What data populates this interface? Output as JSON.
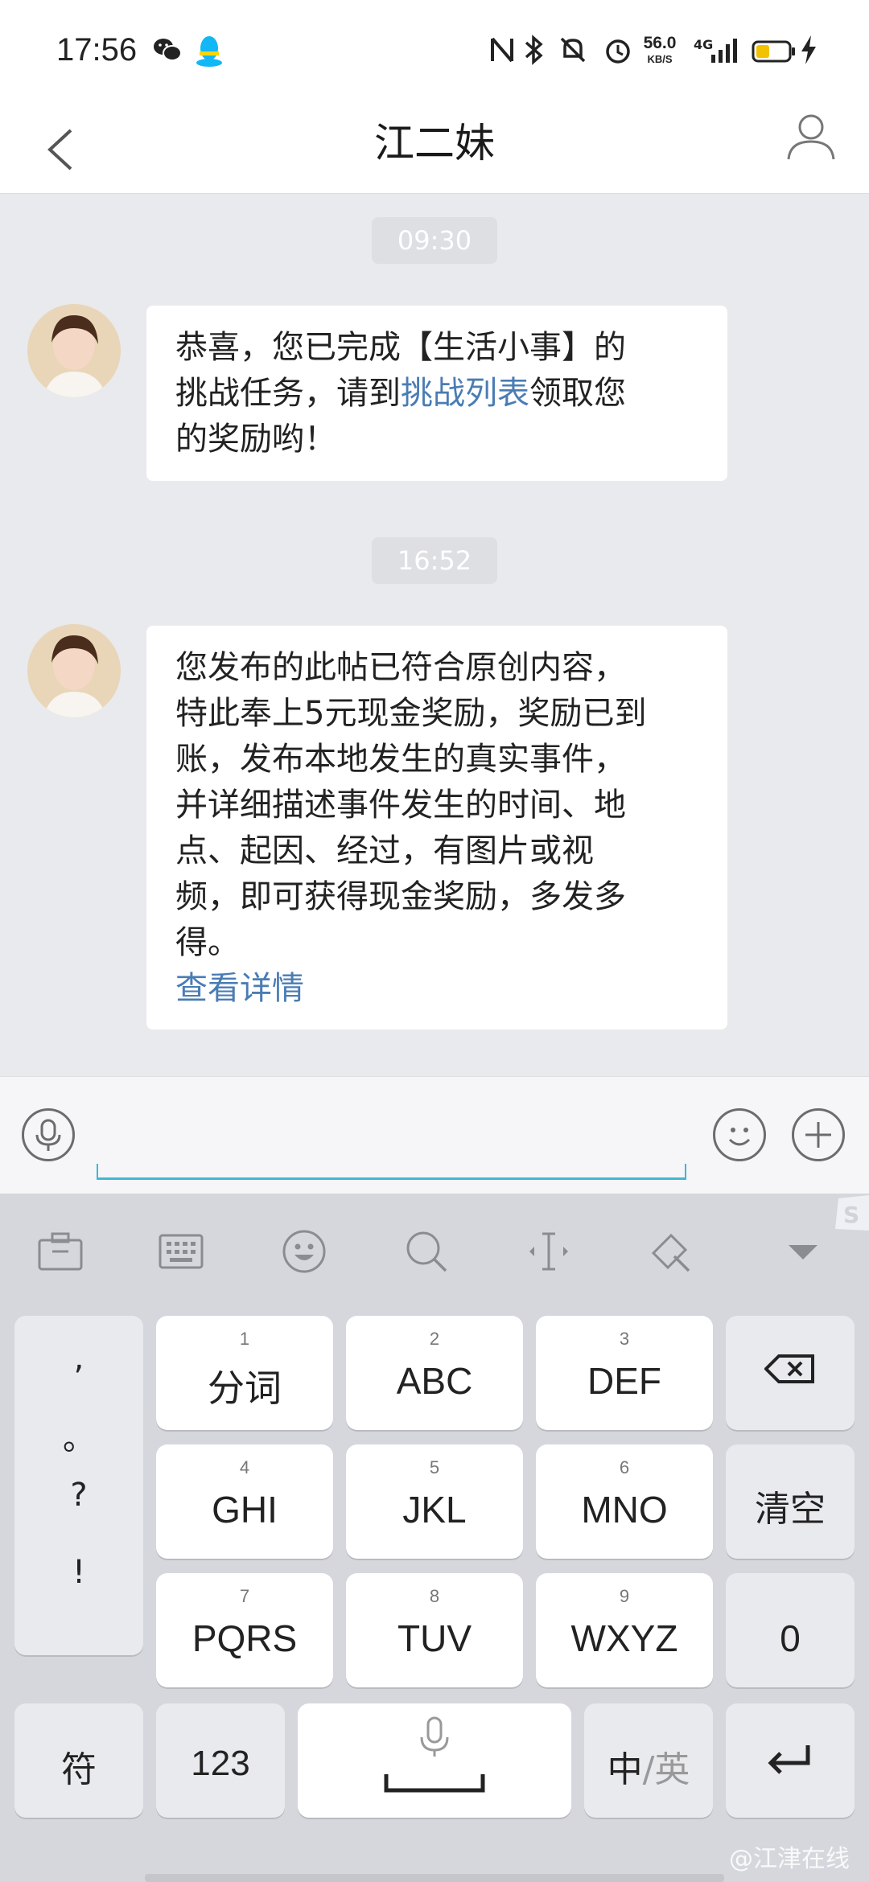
{
  "status_bar": {
    "time": "17:56",
    "net_speed_value": "56.0",
    "net_speed_unit": "KB/S",
    "network": "4G",
    "icons": [
      "wechat-icon",
      "qq-icon",
      "nfc-icon",
      "bluetooth-icon",
      "mute-icon",
      "alarm-icon",
      "signal-icon",
      "battery-icon",
      "charging-icon"
    ]
  },
  "header": {
    "title": "江二妹",
    "back_icon": "chevron-left-icon",
    "profile_icon": "person-icon"
  },
  "messages": [
    {
      "time": "09:30",
      "lines": [
        "恭喜，您已完成【生活小事】的",
        {
          "pre": "挑战任务，请到",
          "link": "挑战列表",
          "post": "领取您"
        },
        "的奖励哟！"
      ]
    },
    {
      "time": "16:52",
      "lines": [
        "您发布的此帖已符合原创内容，",
        "特此奉上5元现金奖励，奖励已到",
        "账，发布本地发生的真实事件，",
        "并详细描述事件发生的时间、地",
        "点、起因、经过，有图片或视",
        "频，即可获得现金奖励，多发多",
        "得。"
      ],
      "link": "查看详情"
    }
  ],
  "input_bar": {
    "voice_icon": "microphone-icon",
    "emoji_icon": "smiley-icon",
    "plus_icon": "plus-icon"
  },
  "keyboard": {
    "toolbar_icons": [
      "toolbox-icon",
      "keyboard-icon",
      "emoji-icon",
      "search-icon",
      "cursor-icon",
      "clipboard-icon",
      "collapse-icon"
    ],
    "punct": [
      ",",
      "。",
      "?",
      "!"
    ],
    "keys": [
      {
        "num": "1",
        "label": "分词"
      },
      {
        "num": "2",
        "label": "ABC"
      },
      {
        "num": "3",
        "label": "DEF"
      },
      {
        "num": "4",
        "label": "GHI"
      },
      {
        "num": "5",
        "label": "JKL"
      },
      {
        "num": "6",
        "label": "MNO"
      },
      {
        "num": "7",
        "label": "PQRS"
      },
      {
        "num": "8",
        "label": "TUV"
      },
      {
        "num": "9",
        "label": "WXYZ"
      }
    ],
    "clear": "清空",
    "zero": "0",
    "symbols": "符",
    "numbers": "123",
    "lang_zh": "中",
    "lang_sep": "/",
    "lang_en": "英"
  },
  "watermark": "@江津在线"
}
